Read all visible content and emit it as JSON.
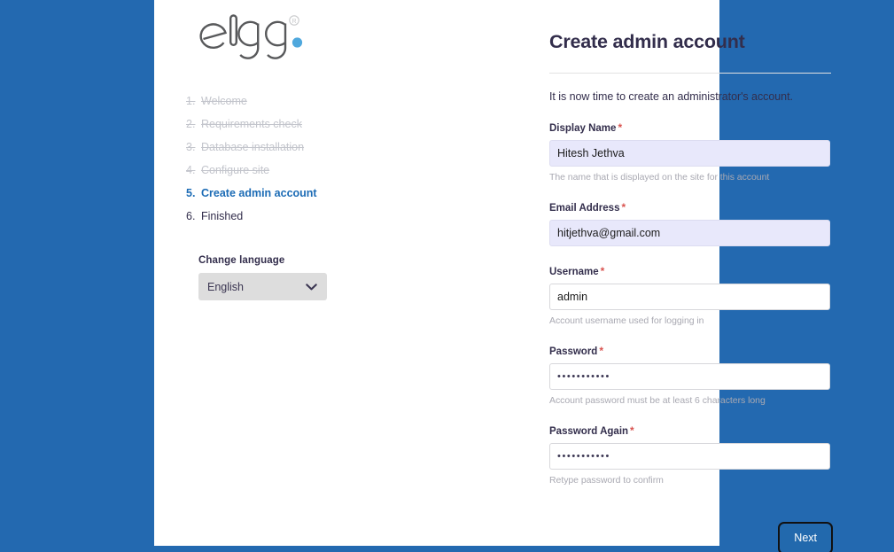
{
  "theme": {
    "page_background": "#2369b0",
    "panel_background": "#ffffff",
    "accent_blue": "#1b6bb5",
    "heading_color": "#332e4c",
    "required_color": "#d9534f",
    "button_background": "#2269ad",
    "autofill_background": "#e8e8fb",
    "logo_dot_color": "#4fa8dd"
  },
  "sidebar": {
    "logo": {
      "wordmark": "elgg",
      "trademark": "®",
      "icon_name": "elgg-logo"
    },
    "steps": [
      {
        "number": "1.",
        "label": "Welcome",
        "state": "done"
      },
      {
        "number": "2.",
        "label": "Requirements check",
        "state": "done"
      },
      {
        "number": "3.",
        "label": "Database installation",
        "state": "done"
      },
      {
        "number": "4.",
        "label": "Configure site",
        "state": "done"
      },
      {
        "number": "5.",
        "label": "Create admin account",
        "state": "active"
      },
      {
        "number": "6.",
        "label": "Finished",
        "state": "pending"
      }
    ],
    "language": {
      "title": "Change language",
      "selected": "English",
      "options": [
        "English"
      ],
      "chevron_icon": "chevron-down-icon"
    }
  },
  "main": {
    "title": "Create admin account",
    "intro": "It is now time to create an administrator's account.",
    "required_marker": "*",
    "fields": [
      {
        "key": "display_name",
        "label": "Display Name",
        "required": true,
        "value": "Hitesh Jethva",
        "placeholder": "",
        "help": "The name that is displayed on the site for this account",
        "autofilled": true,
        "type": "text"
      },
      {
        "key": "email",
        "label": "Email Address",
        "required": true,
        "value": "hitjethva@gmail.com",
        "placeholder": "",
        "help": "",
        "autofilled": true,
        "type": "email"
      },
      {
        "key": "username",
        "label": "Username",
        "required": true,
        "value": "admin",
        "placeholder": "",
        "help": "Account username used for logging in",
        "autofilled": false,
        "type": "text"
      },
      {
        "key": "password",
        "label": "Password",
        "required": true,
        "value": "•••••••••••",
        "placeholder": "",
        "help": "Account password must be at least 6 characters long",
        "autofilled": false,
        "type": "password"
      },
      {
        "key": "password_again",
        "label": "Password Again",
        "required": true,
        "value": "•••••••••••",
        "placeholder": "",
        "help": "Retype password to confirm",
        "autofilled": false,
        "type": "password"
      }
    ],
    "submit_label": "Next"
  }
}
